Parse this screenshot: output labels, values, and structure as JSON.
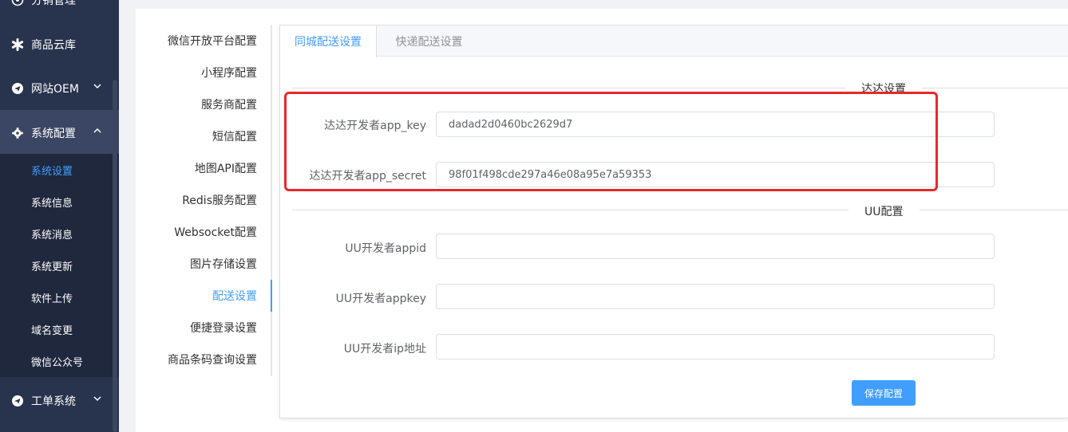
{
  "sidebar": {
    "top_partial_label": "分销管理",
    "menu": [
      {
        "label": "商品云库"
      },
      {
        "label": "网站OEM"
      },
      {
        "label": "系统配置"
      },
      {
        "label": "工单系统"
      }
    ],
    "submenu": [
      {
        "label": "系统设置"
      },
      {
        "label": "系统信息"
      },
      {
        "label": "系统消息"
      },
      {
        "label": "系统更新"
      },
      {
        "label": "软件上传"
      },
      {
        "label": "域名变更"
      },
      {
        "label": "微信公众号"
      }
    ]
  },
  "settings_nav": [
    {
      "label": "微信开放平台配置"
    },
    {
      "label": "小程序配置"
    },
    {
      "label": "服务商配置"
    },
    {
      "label": "短信配置"
    },
    {
      "label": "地图API配置"
    },
    {
      "label": "Redis服务配置"
    },
    {
      "label": "Websocket配置"
    },
    {
      "label": "图片存储设置"
    },
    {
      "label": "配送设置"
    },
    {
      "label": "便捷登录设置"
    },
    {
      "label": "商品条码查询设置"
    }
  ],
  "tabs": [
    {
      "label": "同城配送设置"
    },
    {
      "label": "快递配送设置"
    }
  ],
  "dada": {
    "section_title": "达达设置",
    "app_key_label": "达达开发者app_key",
    "app_key_value": "dadad2d0460bc2629d7",
    "app_secret_label": "达达开发者app_secret",
    "app_secret_value": "98f01f498cde297a46e08a95e7a59353"
  },
  "uu": {
    "section_title": "UU配置",
    "appid_label": "UU开发者appid",
    "appid_value": "",
    "appkey_label": "UU开发者appkey",
    "appkey_value": "",
    "ip_label": "UU开发者ip地址",
    "ip_value": ""
  },
  "save_label": "保存配置",
  "colors": {
    "sidebar_bg": "#28334d",
    "accent": "#409eff",
    "highlight": "#e8282b"
  }
}
